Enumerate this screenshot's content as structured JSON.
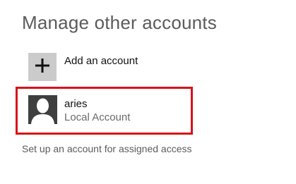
{
  "page": {
    "title": "Manage other accounts"
  },
  "add_account": {
    "label": "Add an account",
    "icon": "plus-icon"
  },
  "accounts": [
    {
      "name": "aries",
      "type": "Local Account",
      "icon": "user-avatar-icon",
      "selected": true
    }
  ],
  "assigned_access": {
    "label": "Set up an account for assigned access"
  },
  "colors": {
    "selection_border": "#d8121a",
    "tile_gray": "#cbcbcb",
    "avatar_bg": "#3f3f3f",
    "title_text": "#5b5b5b"
  }
}
